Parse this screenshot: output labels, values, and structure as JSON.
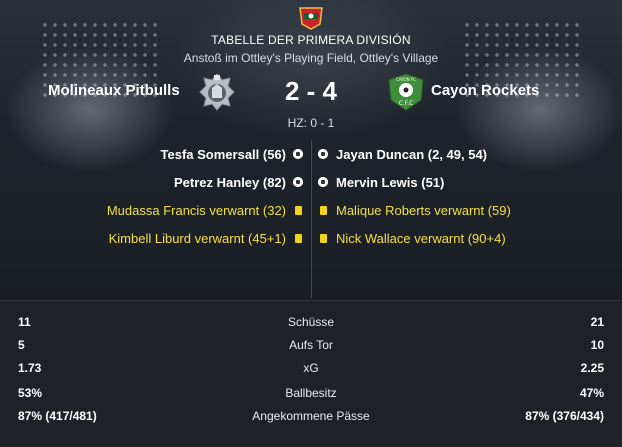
{
  "header": {
    "league": "TABELLE DER PRIMERA DIVISIÓN",
    "venue": "Anstoß im Ottley's Playing Field, Ottley's Village",
    "halftime": "HZ: 0 - 1"
  },
  "home": {
    "name": "Molineaux Pitbulls"
  },
  "away": {
    "name": "Cayon Rockets",
    "badge_text": "CAYON FC",
    "badge_initials": "C.F.C"
  },
  "score": "2 - 4",
  "events": {
    "home": [
      {
        "text": "Tesfa Somersall (56)",
        "type": "goal"
      },
      {
        "text": "Petrez Hanley (82)",
        "type": "goal"
      },
      {
        "text": "Mudassa Francis verwarnt (32)",
        "type": "card"
      },
      {
        "text": "Kimbell Liburd verwarnt (45+1)",
        "type": "card"
      }
    ],
    "away": [
      {
        "text": "Jayan Duncan (2, 49, 54)",
        "type": "goal"
      },
      {
        "text": "Mervin Lewis (51)",
        "type": "goal"
      },
      {
        "text": "Malique Roberts verwarnt (59)",
        "type": "card"
      },
      {
        "text": "Nick Wallace verwarnt (90+4)",
        "type": "card"
      }
    ]
  },
  "stats": [
    {
      "label": "Schüsse",
      "home": "11",
      "away": "21"
    },
    {
      "label": "Aufs Tor",
      "home": "5",
      "away": "10"
    },
    {
      "label": "xG",
      "home": "1.73",
      "away": "2.25"
    },
    {
      "label": "Ballbesitz",
      "home": "53%",
      "away": "47%"
    },
    {
      "label": "Angekommene Pässe",
      "home": "87% (417/481)",
      "away": "87% (376/434)"
    }
  ],
  "colors": {
    "card": "#f3d21b",
    "card_text": "#f0e04a",
    "away_badge": "#3f8f3a"
  }
}
